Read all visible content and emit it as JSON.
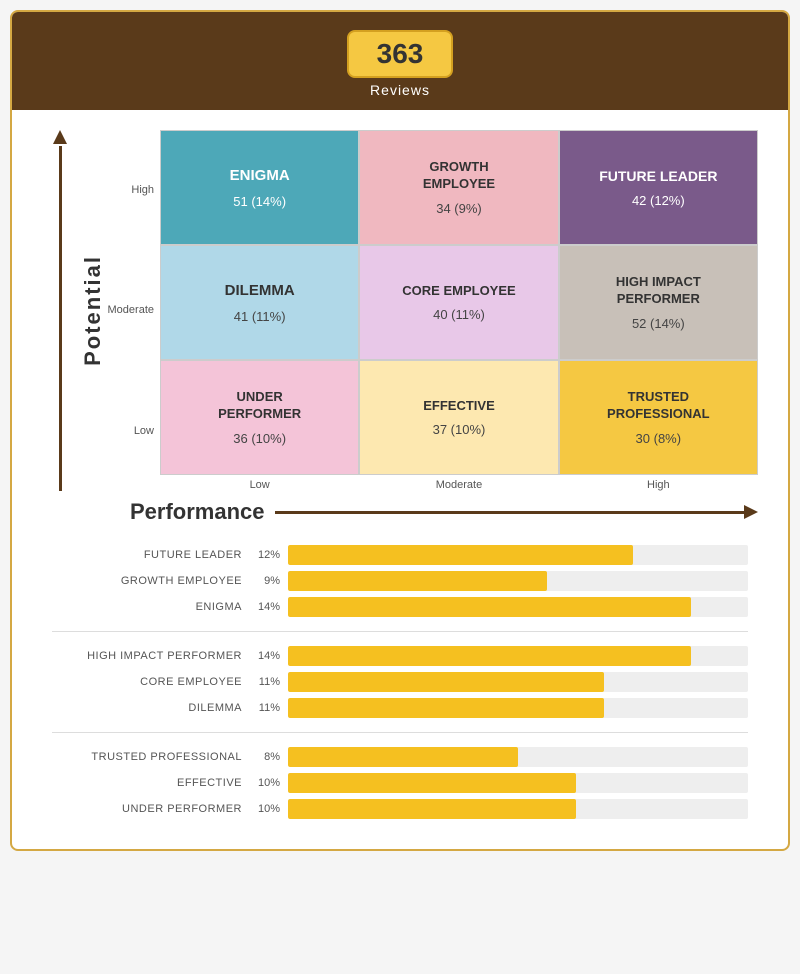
{
  "header": {
    "review_count": "363",
    "reviews_label": "Reviews"
  },
  "matrix": {
    "potential_label": "Potential",
    "performance_label": "Performance",
    "y_labels": [
      "High",
      "Moderate",
      "Low"
    ],
    "x_labels": [
      "Low",
      "Moderate",
      "High"
    ],
    "cells": [
      [
        {
          "id": "enigma",
          "title": "ENIGMA",
          "count": "51 (14%)",
          "color_class": "cell-enigma"
        },
        {
          "id": "growth",
          "title": "GROWTH\nEMPLOYEE",
          "count": "34 (9%)",
          "color_class": "cell-growth"
        },
        {
          "id": "future-leader",
          "title": "FUTURE LEADER",
          "count": "42 (12%)",
          "color_class": "cell-future-leader"
        }
      ],
      [
        {
          "id": "dilemma",
          "title": "DILEMMA",
          "count": "41 (11%)",
          "color_class": "cell-dilemma"
        },
        {
          "id": "core",
          "title": "CORE EMPLOYEE",
          "count": "40 (11%)",
          "color_class": "cell-core"
        },
        {
          "id": "hip",
          "title": "HIGH IMPACT\nPERFORMER",
          "count": "52 (14%)",
          "color_class": "cell-hip"
        }
      ],
      [
        {
          "id": "underperformer",
          "title": "UNDER\nPERFORMER",
          "count": "36 (10%)",
          "color_class": "cell-underperformer"
        },
        {
          "id": "effective",
          "title": "EFFECTIVE",
          "count": "37 (10%)",
          "color_class": "cell-effective"
        },
        {
          "id": "trusted",
          "title": "TRUSTED\nPROFESSIONAL",
          "count": "30 (8%)",
          "color_class": "cell-trusted"
        }
      ]
    ]
  },
  "bar_chart": {
    "groups": [
      {
        "items": [
          {
            "label": "FUTURE LEADER",
            "pct_text": "12%",
            "pct_value": 12
          },
          {
            "label": "GROWTH EMPLOYEE",
            "pct_text": "9%",
            "pct_value": 9
          },
          {
            "label": "ENIGMA",
            "pct_text": "14%",
            "pct_value": 14
          }
        ]
      },
      {
        "items": [
          {
            "label": "HIGH IMPACT PERFORMER",
            "pct_text": "14%",
            "pct_value": 14
          },
          {
            "label": "CORE EMPLOYEE",
            "pct_text": "11%",
            "pct_value": 11
          },
          {
            "label": "DILEMMA",
            "pct_text": "11%",
            "pct_value": 11
          }
        ]
      },
      {
        "items": [
          {
            "label": "TRUSTED PROFESSIONAL",
            "pct_text": "8%",
            "pct_value": 8
          },
          {
            "label": "EFFECTIVE",
            "pct_text": "10%",
            "pct_value": 10
          },
          {
            "label": "UNDER PERFORMER",
            "pct_text": "10%",
            "pct_value": 10
          }
        ]
      }
    ],
    "max_pct": 16
  }
}
